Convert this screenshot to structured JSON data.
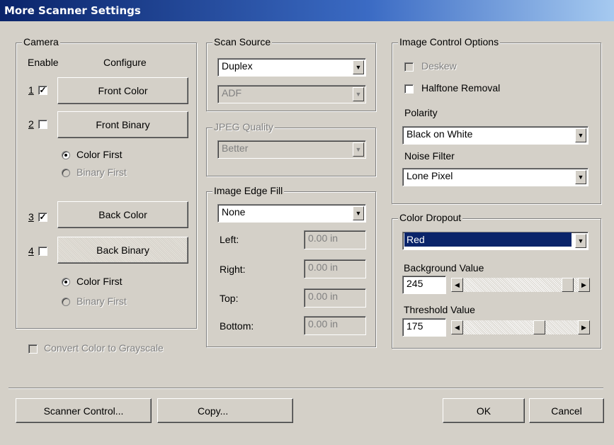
{
  "window": {
    "title": "More Scanner Settings"
  },
  "camera": {
    "legend": "Camera",
    "enable_header": "Enable",
    "configure_header": "Configure",
    "rows": [
      {
        "num": "1",
        "checked": true,
        "label": "Front Color"
      },
      {
        "num": "2",
        "checked": false,
        "label": "Front Binary"
      },
      {
        "num": "3",
        "checked": true,
        "label": "Back Color"
      },
      {
        "num": "4",
        "checked": false,
        "label": "Back Binary"
      }
    ],
    "front_order": {
      "color_first": "Color First",
      "binary_first": "Binary First",
      "selected": "Color First"
    },
    "back_order": {
      "color_first": "Color First",
      "binary_first": "Binary First",
      "selected": "Color First"
    },
    "convert_grayscale": "Convert Color to Grayscale"
  },
  "scan_source": {
    "legend": "Scan Source",
    "value": "Duplex",
    "secondary_value": "ADF"
  },
  "jpeg_quality": {
    "legend": "JPEG Quality",
    "value": "Better"
  },
  "image_edge_fill": {
    "legend": "Image Edge Fill",
    "value": "None",
    "fields": [
      {
        "label": "Left:",
        "value": "0.00 in"
      },
      {
        "label": "Right:",
        "value": "0.00 in"
      },
      {
        "label": "Top:",
        "value": "0.00 in"
      },
      {
        "label": "Bottom:",
        "value": "0.00 in"
      }
    ]
  },
  "image_control": {
    "legend": "Image Control Options",
    "deskew": "Deskew",
    "halftone": "Halftone Removal",
    "polarity_label": "Polarity",
    "polarity_value": "Black on White",
    "noise_label": "Noise Filter",
    "noise_value": "Lone Pixel"
  },
  "color_dropout": {
    "legend": "Color Dropout",
    "value": "Red",
    "background_label": "Background Value",
    "background_value": "245",
    "threshold_label": "Threshold Value",
    "threshold_value": "175",
    "background_level": 0.96,
    "threshold_level": 0.68
  },
  "buttons": {
    "scanner_control": "Scanner Control...",
    "copy": "Copy...",
    "ok": "OK",
    "cancel": "Cancel"
  }
}
